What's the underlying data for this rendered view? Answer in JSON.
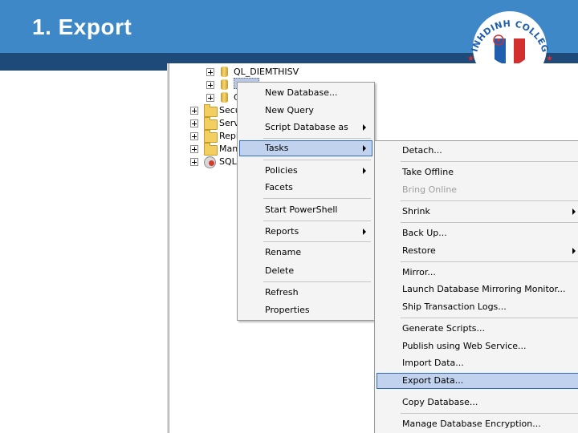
{
  "slide": {
    "title": "1. Export"
  },
  "logo": {
    "text": "BINHDINH COLLEGE"
  },
  "tree": {
    "items": [
      {
        "label": "QL_DIEMTHISV",
        "icon": "database-icon"
      },
      {
        "label": "",
        "icon": "database-icon"
      },
      {
        "label": "C",
        "icon": "database-icon"
      },
      {
        "label": "Secu",
        "icon": "folder-icon"
      },
      {
        "label": "Serv",
        "icon": "folder-icon"
      },
      {
        "label": "Repli",
        "icon": "folder-icon"
      },
      {
        "label": "Mana",
        "icon": "folder-icon"
      },
      {
        "label": "SQL",
        "icon": "sql-agent-icon"
      }
    ]
  },
  "context_menu": {
    "items": [
      "New Database...",
      "New Query",
      "Script Database as",
      "Tasks",
      "Policies",
      "Facets",
      "Start PowerShell",
      "Reports",
      "Rename",
      "Delete",
      "Refresh",
      "Properties"
    ]
  },
  "tasks_menu": {
    "items": [
      "Detach...",
      "Take Offline",
      "Bring Online",
      "Shrink",
      "Back Up...",
      "Restore",
      "Mirror...",
      "Launch Database Mirroring Monitor...",
      "Ship Transaction Logs...",
      "Generate Scripts...",
      "Publish using Web Service...",
      "Import Data...",
      "Export Data...",
      "Copy Database...",
      "Manage Database Encryption..."
    ]
  },
  "colors": {
    "header": "#3e88c7",
    "header_band": "#1d4a78",
    "highlight": "#c1d2ee",
    "highlight_border": "#316ac5"
  }
}
